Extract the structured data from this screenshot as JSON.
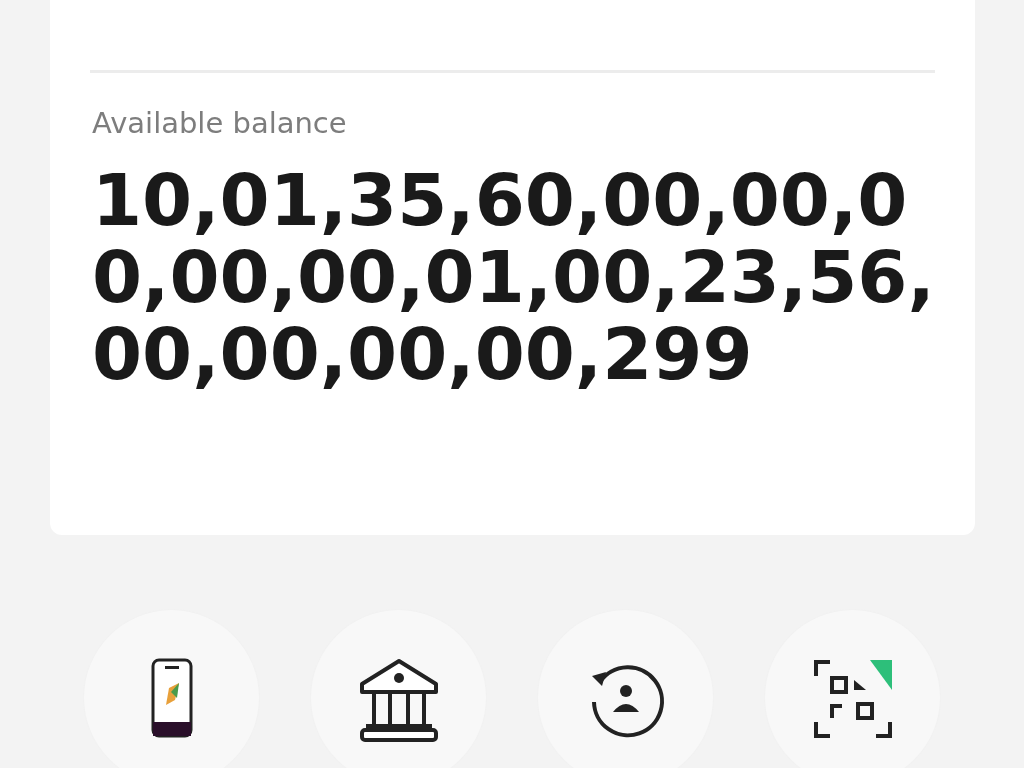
{
  "balance_card": {
    "label": "Available balance",
    "amount": "10,01,35,60,00,00,00,00,00,01,00,23,56,00,00,00,00,299"
  },
  "actions": [
    {
      "kind": "phone"
    },
    {
      "kind": "bank"
    },
    {
      "kind": "contact"
    },
    {
      "kind": "scan"
    }
  ]
}
